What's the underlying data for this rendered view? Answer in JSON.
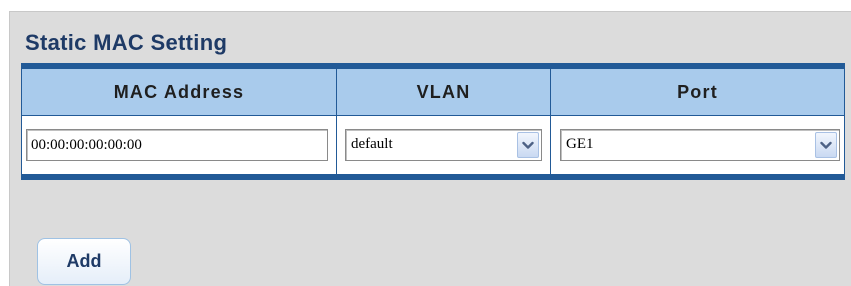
{
  "page": {
    "title": "Static MAC Setting"
  },
  "table": {
    "headers": {
      "mac": "MAC Address",
      "vlan": "VLAN",
      "port": "Port"
    },
    "row": {
      "mac_value": "00:00:00:00:00:00",
      "vlan_value": "default",
      "port_value": "GE1"
    }
  },
  "actions": {
    "add_label": "Add"
  },
  "colors": {
    "panel_bg": "#dcdcdc",
    "header_bg": "#a9cbec",
    "border_accent": "#225a97",
    "title_text": "#1e3a66"
  },
  "icons": {
    "dropdown": "chevron-down-icon"
  }
}
